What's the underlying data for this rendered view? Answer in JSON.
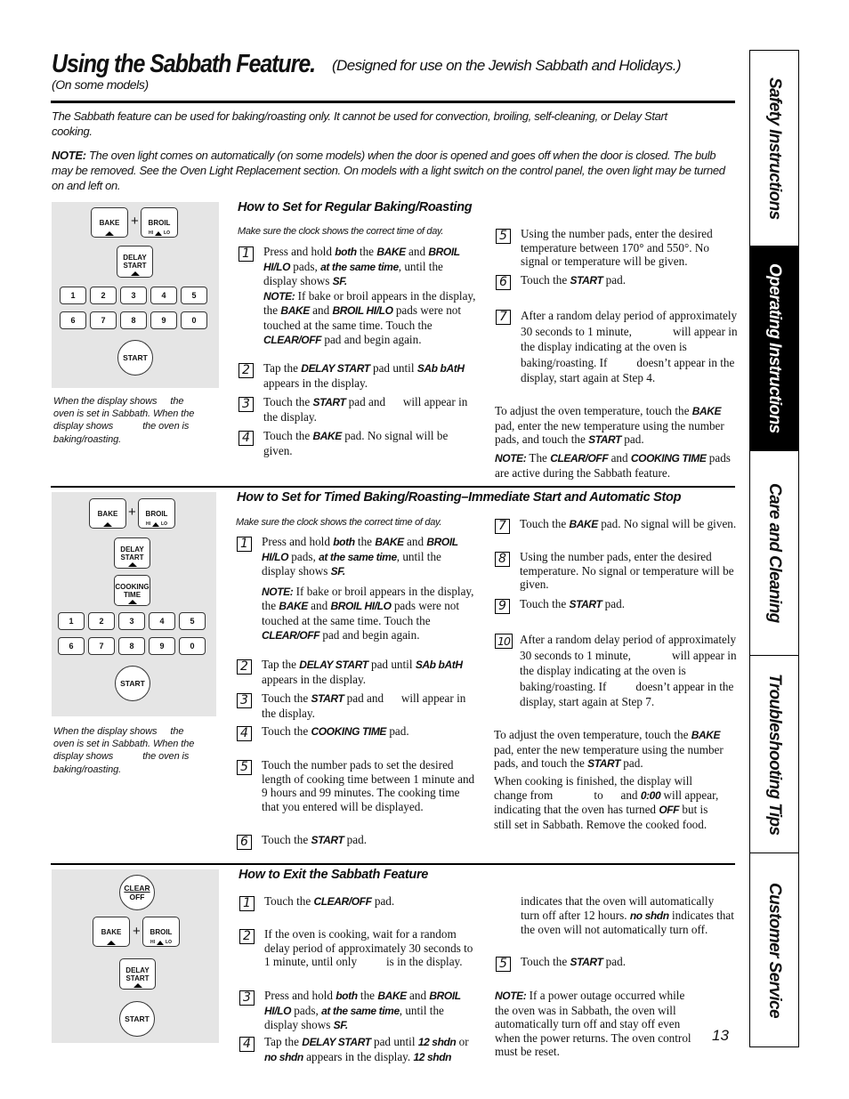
{
  "header": {
    "title": "Using the Sabbath Feature.",
    "subtitle": "(Designed for use on the Jewish Sabbath and Holidays.)",
    "models_note": "(On some models)"
  },
  "intro": {
    "paragraph": "The Sabbath feature can be used for baking/roasting only. It cannot be used for convection, broiling, self-cleaning, or Delay Start cooking.",
    "note_label": "NOTE:",
    "note_text": "The oven light comes on automatically (on some models) when the door is opened and goes off when the door is closed. The bulb may be removed. See the Oven Light Replacement section. On models with a light switch on the control panel, the oven light may be turned on and left on."
  },
  "keypad": {
    "bake": "BAKE",
    "plus": "+",
    "broil": "BROIL",
    "hi": "HI",
    "lo": "LO",
    "delay_1": "DELAY",
    "delay_2": "START",
    "cook_1": "COOKING",
    "cook_2": "TIME",
    "clear_1": "CLEAR",
    "clear_2": "OFF",
    "start": "START",
    "digits": [
      "1",
      "2",
      "3",
      "4",
      "5",
      "6",
      "7",
      "8",
      "9",
      "0"
    ]
  },
  "caption": {
    "l1a": "When the display shows",
    "l1b": "the",
    "l2": "oven is set in Sabbath. When the",
    "l3a": "display shows",
    "l3b": "the oven is",
    "l4": "baking/roasting."
  },
  "section1": {
    "heading": "How to Set for Regular Baking/Roasting",
    "clock_note": "Make sure the clock shows the correct time of day.",
    "steps": [
      {
        "n": "1"
      },
      {
        "n": "2"
      },
      {
        "n": "3"
      },
      {
        "n": "4"
      },
      {
        "n": "5"
      },
      {
        "n": "6"
      },
      {
        "n": "7"
      }
    ]
  },
  "section2": {
    "heading": "How to Set for Timed Baking/Roasting–Immediate Start and Automatic Stop",
    "clock_note": "Make sure the clock shows the correct time of day.",
    "steps": [
      {
        "n": "1"
      },
      {
        "n": "2"
      },
      {
        "n": "3"
      },
      {
        "n": "4"
      },
      {
        "n": "5"
      },
      {
        "n": "6"
      },
      {
        "n": "7"
      },
      {
        "n": "8"
      },
      {
        "n": "9"
      },
      {
        "n": "10"
      }
    ]
  },
  "section3": {
    "heading": "How to Exit the Sabbath Feature",
    "steps": [
      {
        "n": "1"
      },
      {
        "n": "2"
      },
      {
        "n": "3"
      },
      {
        "n": "4"
      },
      {
        "n": "5"
      }
    ]
  },
  "text": {
    "press_hold_a": "Press and hold ",
    "both": "both",
    "the": " the ",
    "bake": "BAKE",
    "and": " and ",
    "broil": "BROIL",
    "hilo": "HI/LO",
    "pads_comma": " pads, ",
    "same_time": "at the same time",
    "until_the": ", until the",
    "display_shows": "display shows ",
    "sf": "SF.",
    "note": "NOTE:",
    "note1a": " If bake or broil appears in the display, the ",
    "broil_hilo": "BROIL HI/LO",
    "note1b": " pads were not touched at the same time. Touch the ",
    "clear_off": "CLEAR/OFF",
    "note1c": " pad and begin again.",
    "tap_the": "Tap the ",
    "delay_start": "DELAY START",
    "pad_until": " pad until ",
    "sabbath": "SAb bAtH",
    "appears": " appears in the display.",
    "touch_the": "Touch the ",
    "start": "START",
    "start_will": " pad and   will appear in the display.",
    "bake_no_signal": " pad. No signal will be given.",
    "step5_s1": "Using the number pads, enter the desired temperature between 170° and 550°. No signal or temperature will be given.",
    "pad": " pad.",
    "step7_s1": "After a random delay period of approximately 30 seconds to 1 minute,     will appear in the display indicating at the oven is baking/roasting. If    doesn’t appear in the display, start again at Step 4.",
    "adjust_a": "To adjust the oven temperature, touch the ",
    "adjust_b": " pad, enter the new temperature using the number pads, and touch the ",
    "note_active_a": " The ",
    "cooking_time": "COOKING TIME",
    "note_active_b": " pads are active during the Sabbath feature.",
    "step5_s2": "Touch the number pads to set the desired length of cooking time between 1 minute and 9 hours and 99 minutes. The cooking time that you entered will be displayed.",
    "step8_s2": "Using the number pads, enter the desired temperature. No signal or temperature will be given.",
    "step10_s2": "After a random delay period of approximately 30 seconds to 1 minute,     will appear in the display indicating at the oven is baking/roasting. If    doesn’t appear in the display, start again at Step 7.",
    "finished_a": "When cooking is finished, the display will change from     to   and ",
    "zero": "0:00",
    "finished_b": " will appear, indicating that the oven has turned ",
    "off": "OFF",
    "finished_c": " but is still set in Sabbath. Remove the cooked food.",
    "exit2": "If the oven is cooking, wait for a random delay period of approximately 30 seconds to 1 minute, until only    is in the display.",
    "twelve_shdn": "12 shdn",
    "or": " or ",
    "no_shdn": "no shdn",
    "appears_display": " appears in the display. ",
    "exit4_cont_a": "indicates that the oven will automatically turn off after 12 hours. ",
    "exit4_cont_b": " indicates that the oven will not automatically turn off.",
    "power_note": " If a power outage occurred while the oven was in Sabbath, the oven will automatically turn off and stay off even when the power returns. The oven control must be reset."
  },
  "side_tabs": [
    {
      "label": "Safety Instructions",
      "active": false
    },
    {
      "label": "Operating Instructions",
      "active": true
    },
    {
      "label": "Care and Cleaning",
      "active": false
    },
    {
      "label": "Troubleshooting Tips",
      "active": false
    },
    {
      "label": "Customer Service",
      "active": false
    }
  ],
  "page_number": "13"
}
